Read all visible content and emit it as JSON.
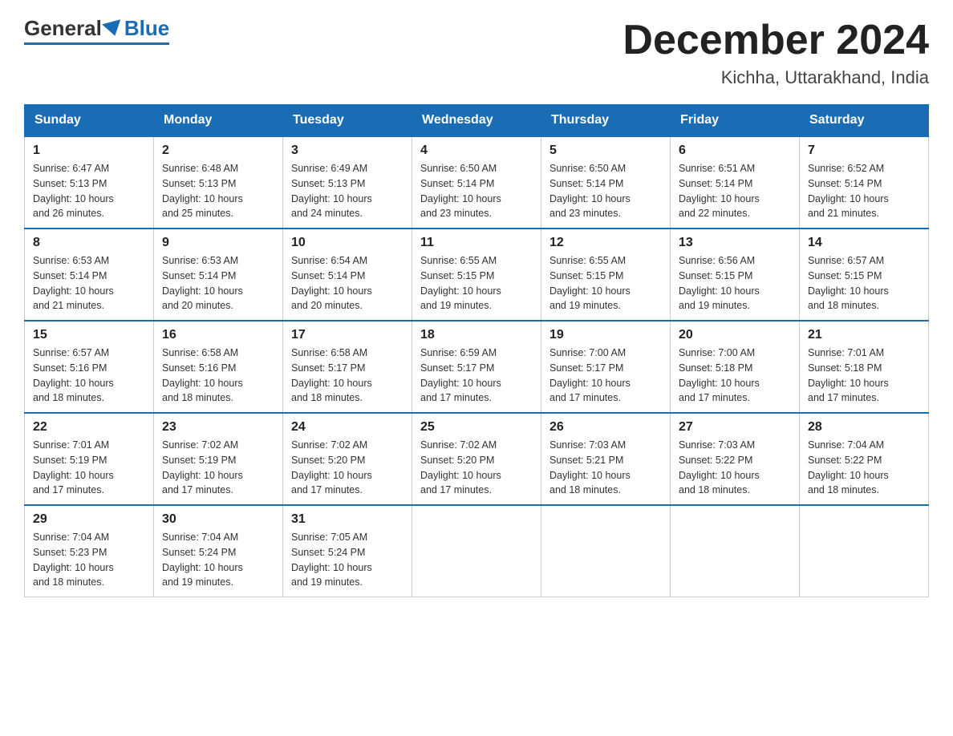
{
  "logo": {
    "general": "General",
    "blue": "Blue"
  },
  "title": "December 2024",
  "subtitle": "Kichha, Uttarakhand, India",
  "days_of_week": [
    "Sunday",
    "Monday",
    "Tuesday",
    "Wednesday",
    "Thursday",
    "Friday",
    "Saturday"
  ],
  "weeks": [
    [
      {
        "day": "1",
        "sunrise": "6:47 AM",
        "sunset": "5:13 PM",
        "daylight": "10 hours and 26 minutes."
      },
      {
        "day": "2",
        "sunrise": "6:48 AM",
        "sunset": "5:13 PM",
        "daylight": "10 hours and 25 minutes."
      },
      {
        "day": "3",
        "sunrise": "6:49 AM",
        "sunset": "5:13 PM",
        "daylight": "10 hours and 24 minutes."
      },
      {
        "day": "4",
        "sunrise": "6:50 AM",
        "sunset": "5:14 PM",
        "daylight": "10 hours and 23 minutes."
      },
      {
        "day": "5",
        "sunrise": "6:50 AM",
        "sunset": "5:14 PM",
        "daylight": "10 hours and 23 minutes."
      },
      {
        "day": "6",
        "sunrise": "6:51 AM",
        "sunset": "5:14 PM",
        "daylight": "10 hours and 22 minutes."
      },
      {
        "day": "7",
        "sunrise": "6:52 AM",
        "sunset": "5:14 PM",
        "daylight": "10 hours and 21 minutes."
      }
    ],
    [
      {
        "day": "8",
        "sunrise": "6:53 AM",
        "sunset": "5:14 PM",
        "daylight": "10 hours and 21 minutes."
      },
      {
        "day": "9",
        "sunrise": "6:53 AM",
        "sunset": "5:14 PM",
        "daylight": "10 hours and 20 minutes."
      },
      {
        "day": "10",
        "sunrise": "6:54 AM",
        "sunset": "5:14 PM",
        "daylight": "10 hours and 20 minutes."
      },
      {
        "day": "11",
        "sunrise": "6:55 AM",
        "sunset": "5:15 PM",
        "daylight": "10 hours and 19 minutes."
      },
      {
        "day": "12",
        "sunrise": "6:55 AM",
        "sunset": "5:15 PM",
        "daylight": "10 hours and 19 minutes."
      },
      {
        "day": "13",
        "sunrise": "6:56 AM",
        "sunset": "5:15 PM",
        "daylight": "10 hours and 19 minutes."
      },
      {
        "day": "14",
        "sunrise": "6:57 AM",
        "sunset": "5:15 PM",
        "daylight": "10 hours and 18 minutes."
      }
    ],
    [
      {
        "day": "15",
        "sunrise": "6:57 AM",
        "sunset": "5:16 PM",
        "daylight": "10 hours and 18 minutes."
      },
      {
        "day": "16",
        "sunrise": "6:58 AM",
        "sunset": "5:16 PM",
        "daylight": "10 hours and 18 minutes."
      },
      {
        "day": "17",
        "sunrise": "6:58 AM",
        "sunset": "5:17 PM",
        "daylight": "10 hours and 18 minutes."
      },
      {
        "day": "18",
        "sunrise": "6:59 AM",
        "sunset": "5:17 PM",
        "daylight": "10 hours and 17 minutes."
      },
      {
        "day": "19",
        "sunrise": "7:00 AM",
        "sunset": "5:17 PM",
        "daylight": "10 hours and 17 minutes."
      },
      {
        "day": "20",
        "sunrise": "7:00 AM",
        "sunset": "5:18 PM",
        "daylight": "10 hours and 17 minutes."
      },
      {
        "day": "21",
        "sunrise": "7:01 AM",
        "sunset": "5:18 PM",
        "daylight": "10 hours and 17 minutes."
      }
    ],
    [
      {
        "day": "22",
        "sunrise": "7:01 AM",
        "sunset": "5:19 PM",
        "daylight": "10 hours and 17 minutes."
      },
      {
        "day": "23",
        "sunrise": "7:02 AM",
        "sunset": "5:19 PM",
        "daylight": "10 hours and 17 minutes."
      },
      {
        "day": "24",
        "sunrise": "7:02 AM",
        "sunset": "5:20 PM",
        "daylight": "10 hours and 17 minutes."
      },
      {
        "day": "25",
        "sunrise": "7:02 AM",
        "sunset": "5:20 PM",
        "daylight": "10 hours and 17 minutes."
      },
      {
        "day": "26",
        "sunrise": "7:03 AM",
        "sunset": "5:21 PM",
        "daylight": "10 hours and 18 minutes."
      },
      {
        "day": "27",
        "sunrise": "7:03 AM",
        "sunset": "5:22 PM",
        "daylight": "10 hours and 18 minutes."
      },
      {
        "day": "28",
        "sunrise": "7:04 AM",
        "sunset": "5:22 PM",
        "daylight": "10 hours and 18 minutes."
      }
    ],
    [
      {
        "day": "29",
        "sunrise": "7:04 AM",
        "sunset": "5:23 PM",
        "daylight": "10 hours and 18 minutes."
      },
      {
        "day": "30",
        "sunrise": "7:04 AM",
        "sunset": "5:24 PM",
        "daylight": "10 hours and 19 minutes."
      },
      {
        "day": "31",
        "sunrise": "7:05 AM",
        "sunset": "5:24 PM",
        "daylight": "10 hours and 19 minutes."
      },
      null,
      null,
      null,
      null
    ]
  ],
  "labels": {
    "sunrise": "Sunrise:",
    "sunset": "Sunset:",
    "daylight": "Daylight:"
  }
}
